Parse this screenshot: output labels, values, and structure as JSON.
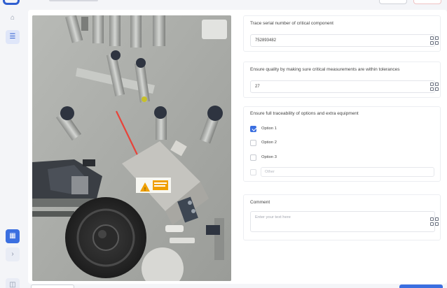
{
  "sidebar": {
    "items": [
      {
        "icon": "home-icon",
        "glyph": "⌂"
      },
      {
        "icon": "checklist-icon",
        "glyph": "☰"
      },
      {
        "icon": "grid-icon",
        "glyph": "▦"
      },
      {
        "icon": "chevron-right-icon",
        "glyph": "›"
      },
      {
        "icon": "account-icon",
        "glyph": "◫"
      }
    ]
  },
  "photo": {
    "alt": "Machine with warning label and red arrow"
  },
  "checklist": {
    "serial": {
      "title": "Trace serial number of critical component",
      "value": "752893482"
    },
    "measurement": {
      "title": "Ensure quality by making sure critical measurements are within tolerances",
      "value": "27"
    },
    "options": {
      "title": "Ensure full traceability of options and extra equipment",
      "items": [
        {
          "label": "Option 1",
          "checked": true
        },
        {
          "label": "Option 2",
          "checked": false
        },
        {
          "label": "Option 3",
          "checked": false
        }
      ],
      "other_placeholder": "Other"
    },
    "comment": {
      "title": "Comment",
      "placeholder": "Enter your text here"
    }
  },
  "colors": {
    "accent": "#3b6fe0",
    "arrow": "#e8433a",
    "warning": "#f0a000"
  }
}
